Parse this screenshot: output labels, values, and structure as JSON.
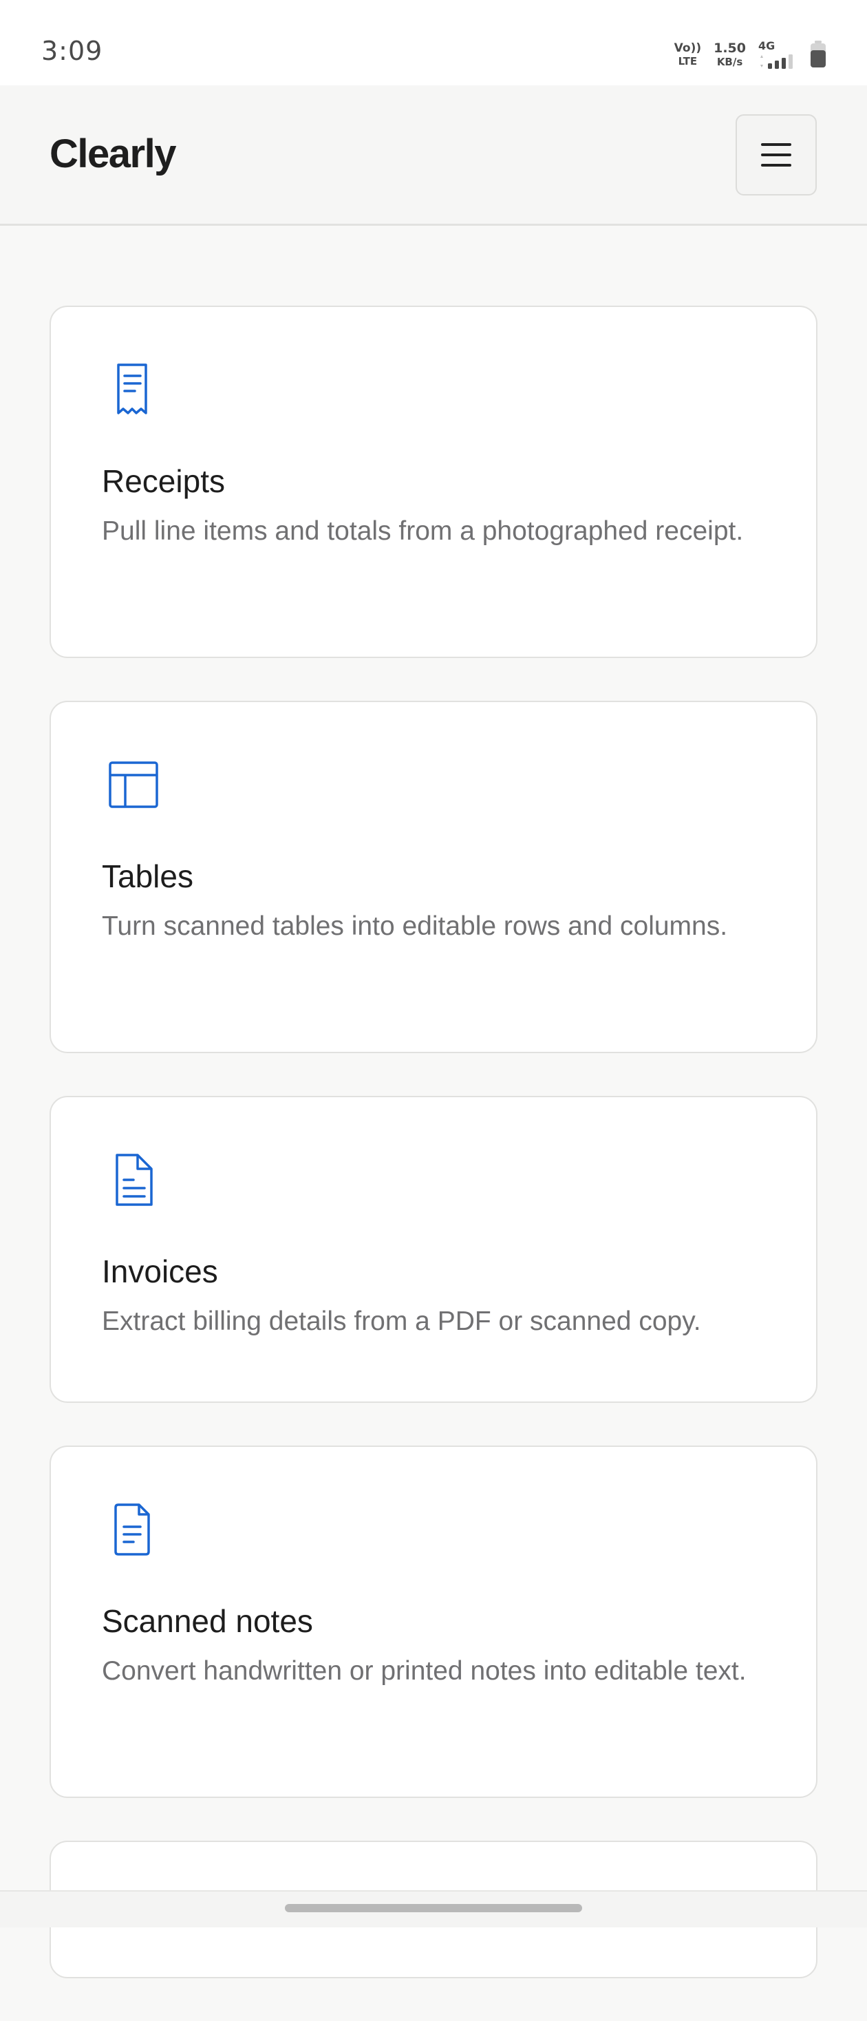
{
  "status_bar": {
    "time": "3:09",
    "volte_top": "Vo))",
    "volte_bottom": "LTE",
    "speed_value": "1.50",
    "speed_unit": "KB/s",
    "network": "4G"
  },
  "header": {
    "brand": "Clearly",
    "menu_icon": "hamburger-menu-icon"
  },
  "accent_color": "#1a66d2",
  "cards": [
    {
      "title": "Receipts",
      "description": "Pull line items and totals from a photographed receipt.",
      "icon": "receipt-icon"
    },
    {
      "title": "Tables",
      "description": "Turn scanned tables into editable rows and columns.",
      "icon": "table-icon"
    },
    {
      "title": "Invoices",
      "description": "Extract billing details from a PDF or scanned copy.",
      "icon": "invoice-document-icon"
    },
    {
      "title": "Scanned notes",
      "description": "Convert handwritten or printed notes into editable text.",
      "icon": "notes-document-icon"
    }
  ]
}
